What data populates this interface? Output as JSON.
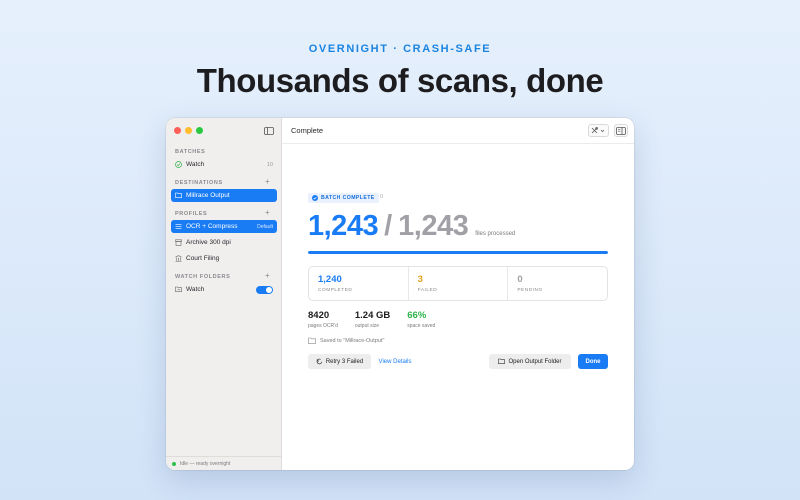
{
  "hero": {
    "eyebrow": "OVERNIGHT · CRASH-SAFE",
    "headline": "Thousands of scans, done"
  },
  "sidebar": {
    "sections": {
      "batches": "BATCHES",
      "destinations": "DESTINATIONS",
      "profiles": "PROFILES",
      "watch_folders": "WATCH FOLDERS"
    },
    "batches": [
      {
        "label": "Watch",
        "count": "10",
        "icon": "check-circle-icon"
      }
    ],
    "destinations": [
      {
        "label": "Millrace Output",
        "icon": "folder-icon",
        "selected": true
      }
    ],
    "profiles": [
      {
        "label": "OCR + Compress",
        "tag": "Default",
        "icon": "sliders-icon",
        "selected": true
      },
      {
        "label": "Archive 300 dpi",
        "icon": "archive-box-icon"
      },
      {
        "label": "Court Filing",
        "icon": "building-icon"
      }
    ],
    "watch_folders": [
      {
        "label": "Watch",
        "icon": "folder-arrow-icon",
        "enabled": true
      }
    ],
    "status": "Idle — ready overnight"
  },
  "window": {
    "title": "Complete"
  },
  "result": {
    "badge": "BATCH COMPLETE",
    "badge_extra": "0",
    "processed": "1,243",
    "separator": "/",
    "total": "1,243",
    "caption": "files processed",
    "progress": 1.0,
    "stats": [
      {
        "value": "1,240",
        "label": "COMPLETED",
        "color": "#1a7cf5"
      },
      {
        "value": "3",
        "label": "FAILED",
        "color": "#e3a21a"
      },
      {
        "value": "0",
        "label": "PENDING",
        "color": "#a0a0a6"
      }
    ],
    "metrics": [
      {
        "value": "8420",
        "label": "pages OCR'd",
        "green": false
      },
      {
        "value": "1.24 GB",
        "label": "output size",
        "green": false
      },
      {
        "value": "66%",
        "label": "space saved",
        "green": true
      }
    ],
    "saved_to": "Saved to \"Millrace-Output\"",
    "buttons": {
      "retry": "Retry 3 Failed",
      "details": "View Details",
      "open_folder": "Open Output Folder",
      "done": "Done"
    }
  },
  "colors": {
    "accent": "#1a7cf5",
    "warning": "#e3a21a",
    "success": "#2fb34a"
  }
}
